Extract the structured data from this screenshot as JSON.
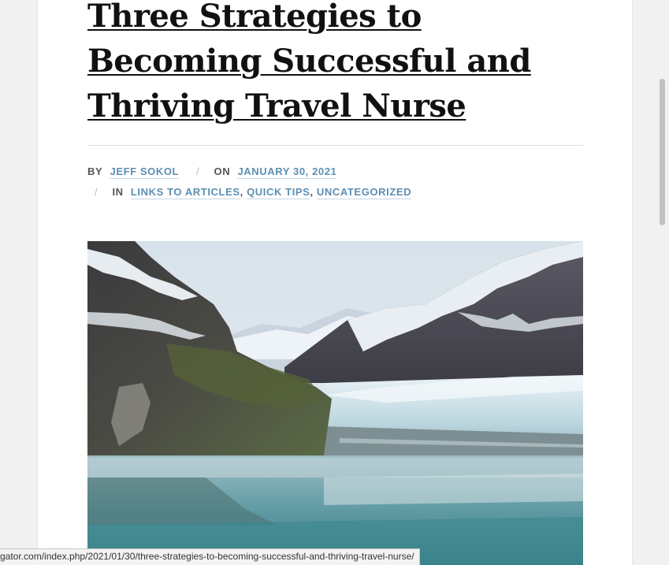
{
  "post": {
    "title": "Three Strategies to Becoming Successful and Thriving Travel Nurse",
    "meta": {
      "by_prefix": "By",
      "author": "Jeff Sokol",
      "separator": "/",
      "on_prefix": "On",
      "date": "January 30, 2021",
      "in_prefix": "In",
      "categories": [
        "Links to Articles",
        "Quick Tips",
        "Uncategorized"
      ],
      "category_delimiter": ","
    },
    "featured_image": {
      "icon": "glacier-landscape-photo"
    }
  },
  "status_bar": {
    "url": "gator.com/index.php/2021/01/30/three-strategies-to-becoming-successful-and-thriving-travel-nurse/"
  },
  "colors": {
    "link": "#5b8fb3",
    "title": "#111111",
    "meta_text": "#555555",
    "background": "#f1f1f1"
  }
}
